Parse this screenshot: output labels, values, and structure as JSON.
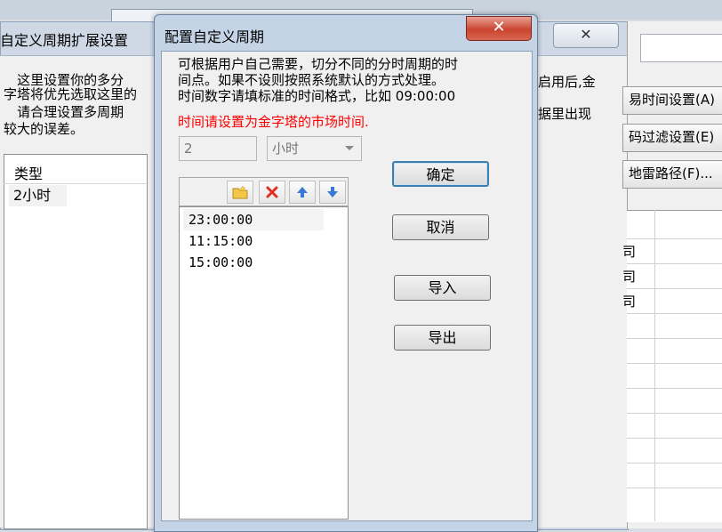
{
  "back_window": {
    "title": "自定义周期扩展设置",
    "close_glyph": "✕",
    "paragraph_lines": [
      "    这里设置你的多分",
      "字塔将优先选取这里的",
      "    请合理设置多周期",
      "较大的误差。"
    ],
    "right_text_lines": [
      "启用后,金",
      "",
      "",
      "据里出现"
    ],
    "list_header": "类型",
    "list_items": [
      "2小时"
    ]
  },
  "right_panel": {
    "buttons": [
      "易时间设置(A)",
      "码过滤设置(E)",
      "地雷路径(F)..."
    ],
    "grid_cells": [
      "司",
      "司",
      "司"
    ]
  },
  "dialog": {
    "title": "配置自定义周期",
    "close_glyph": "✕",
    "description_lines": [
      "可根据用户自己需要，切分不同的分时周期的时",
      "间点。如果不设则按照系统默认的方式处理。",
      "时间数字请填标准的时间格式，比如 09:00:00"
    ],
    "warning": "时间请设置为金字塔的市场时间.",
    "period_value": "2",
    "period_unit": "小时",
    "times": [
      "23:00:00",
      "11:15:00",
      "15:00:00"
    ],
    "buttons": {
      "ok": "确定",
      "cancel": "取消",
      "import": "导入",
      "export": "导出"
    }
  },
  "colors": {
    "warning": "#ff0000",
    "title_bar": "#c4d4e6",
    "close_button": "#c9442f"
  }
}
